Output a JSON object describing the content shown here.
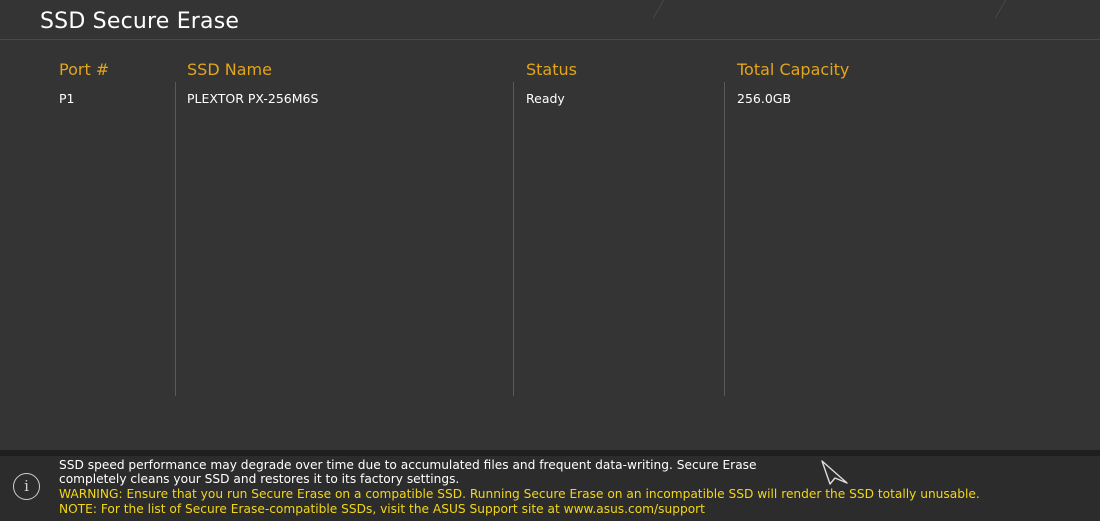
{
  "page": {
    "title": "SSD Secure Erase"
  },
  "table": {
    "headers": {
      "port": "Port #",
      "name": "SSD Name",
      "status": "Status",
      "capacity": "Total Capacity"
    },
    "rows": [
      {
        "port": "P1",
        "name": "PLEXTOR PX-256M6S",
        "status": "Ready",
        "capacity": "256.0GB"
      }
    ]
  },
  "help": {
    "icon": "info-icon",
    "line1": "SSD speed performance may degrade over time due to accumulated files and frequent data-writing. Secure Erase",
    "line2": "completely cleans your SSD and restores it to its factory settings.",
    "warning": "WARNING: Ensure that you run Secure Erase on a compatible SSD. Running Secure Erase on an incompatible SSD will render the SSD totally unusable.",
    "note": "NOTE: For the list of Secure Erase-compatible SSDs, visit the ASUS Support site at www.asus.com/support"
  },
  "colors": {
    "background": "#343434",
    "header_accent": "#e3a51a",
    "warning_text": "#f2d61a",
    "text": "#ffffff"
  }
}
